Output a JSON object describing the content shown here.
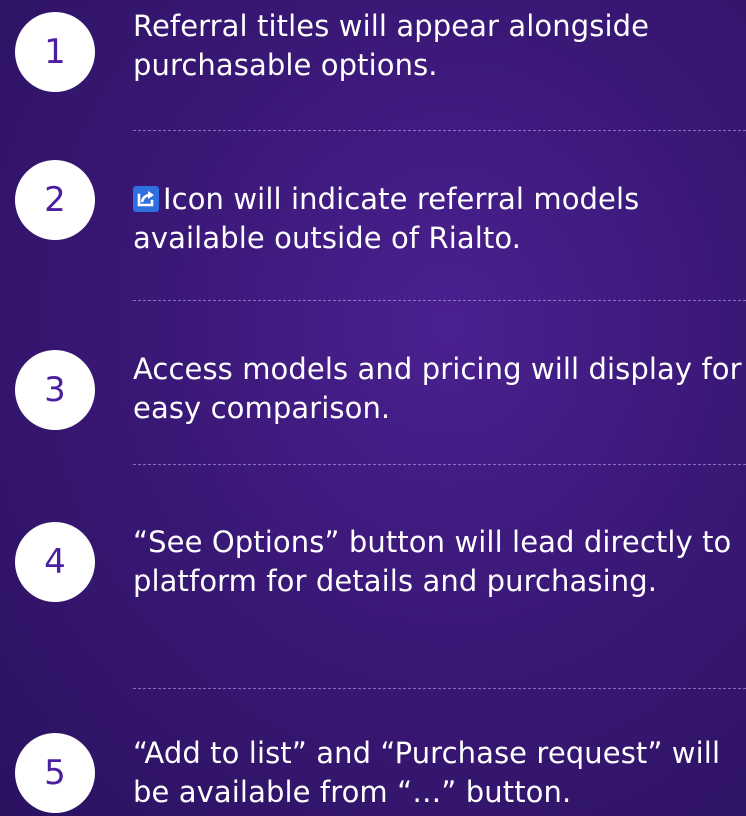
{
  "colors": {
    "background": "#3a1877",
    "badge_fill": "#ffffff",
    "badge_number": "#4b1fa0",
    "text": "#ffffff",
    "share_icon": "#2f6fe0"
  },
  "steps": [
    {
      "number": "1",
      "text": "Referral titles will appear alongside purchasable options."
    },
    {
      "number": "2",
      "icon": "share-icon",
      "text": "Icon will indicate referral models available outside of Rialto."
    },
    {
      "number": "3",
      "text": "Access models and pricing will display for easy comparison."
    },
    {
      "number": "4",
      "text": "“See Options” button will lead directly to platform for details and purchasing."
    },
    {
      "number": "5",
      "text": "“Add to list” and “Purchase request” will be available from “…” button."
    }
  ]
}
